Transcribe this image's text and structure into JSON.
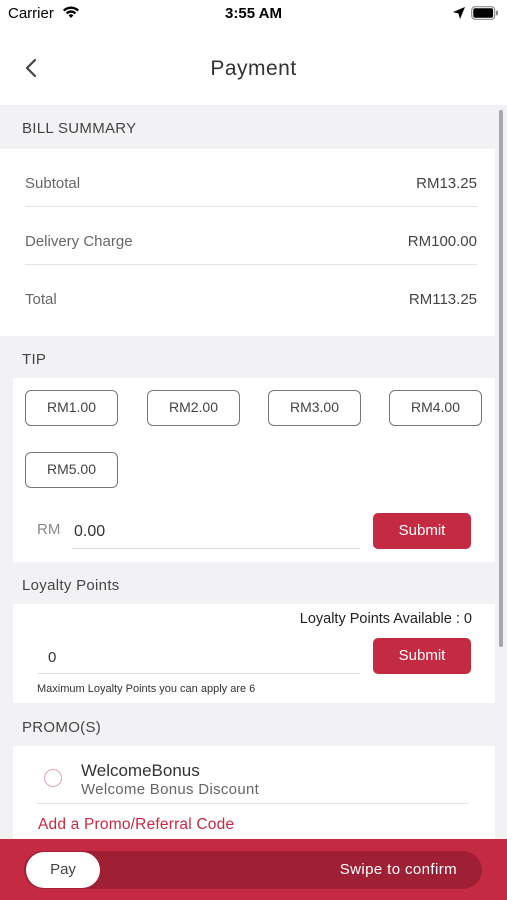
{
  "status_bar": {
    "carrier": "Carrier",
    "time": "3:55 AM"
  },
  "header": {
    "title": "Payment"
  },
  "bill_summary": {
    "heading": "BILL SUMMARY",
    "rows": [
      {
        "label": "Subtotal",
        "value": "RM13.25"
      },
      {
        "label": "Delivery Charge",
        "value": "RM100.00"
      },
      {
        "label": "Total",
        "value": "RM113.25"
      }
    ]
  },
  "tip": {
    "heading": "TIP",
    "options": [
      "RM1.00",
      "RM2.00",
      "RM3.00",
      "RM4.00",
      "RM5.00"
    ],
    "currency_label": "RM",
    "amount_value": "0.00",
    "submit_label": "Submit"
  },
  "loyalty": {
    "heading": "Loyalty Points",
    "available_text": "Loyalty Points Available : 0",
    "input_value": "0",
    "submit_label": "Submit",
    "note": "Maximum Loyalty Points you can apply are 6"
  },
  "promos": {
    "heading": "PROMO(S)",
    "items": [
      {
        "name": "WelcomeBonus",
        "description": "Welcome Bonus Discount",
        "selected": false
      }
    ],
    "add_link": "Add a Promo/Referral Code"
  },
  "footer": {
    "knob_label": "Pay",
    "hint": "Swipe to confirm"
  },
  "colors": {
    "accent": "#c52a43",
    "accent_dark": "#9f2035",
    "background": "#f2f2f4"
  }
}
